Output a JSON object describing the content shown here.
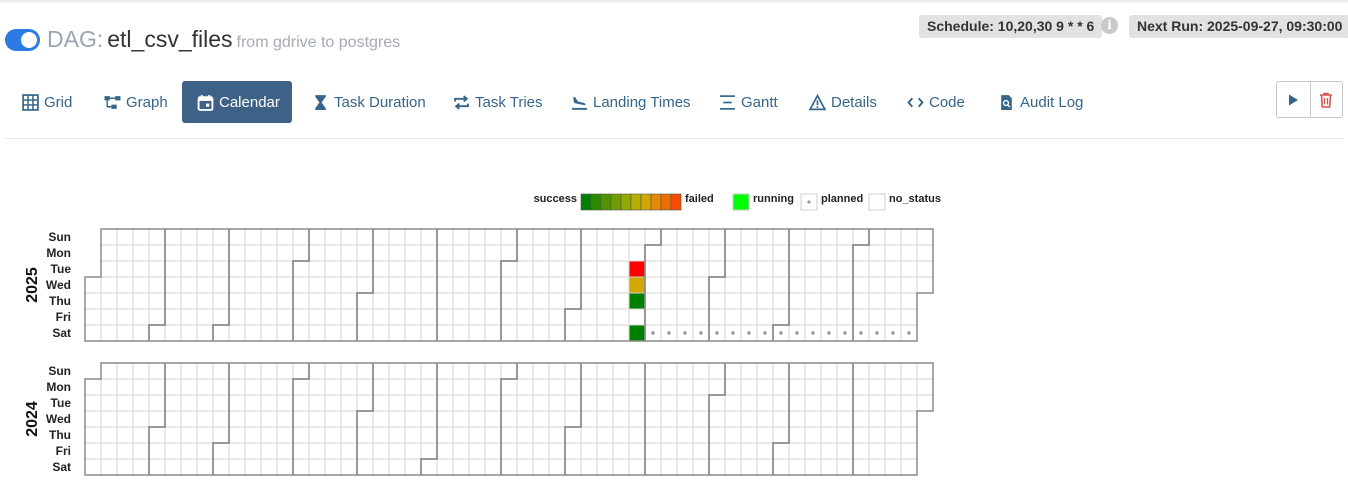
{
  "dag": {
    "toggle_on": true,
    "prefix": "DAG:",
    "name": "etl_csv_files",
    "description": "from gdrive to postgres"
  },
  "schedule_label": "Schedule: 10,20,30 9 * * 6",
  "next_run_label": "Next Run: 2025-09-27, 09:30:00",
  "tabs": [
    {
      "label": "Grid",
      "icon": "grid-icon",
      "active": false
    },
    {
      "label": "Graph",
      "icon": "graph-icon",
      "active": false
    },
    {
      "label": "Calendar",
      "icon": "calendar-icon",
      "active": true
    },
    {
      "label": "Task Duration",
      "icon": "hourglass-icon",
      "active": false
    },
    {
      "label": "Task Tries",
      "icon": "repeat-icon",
      "active": false
    },
    {
      "label": "Landing Times",
      "icon": "plane-landing-icon",
      "active": false
    },
    {
      "label": "Gantt",
      "icon": "gantt-icon",
      "active": false
    },
    {
      "label": "Details",
      "icon": "warning-triangle-icon",
      "active": false
    },
    {
      "label": "Code",
      "icon": "code-icon",
      "active": false
    },
    {
      "label": "Audit Log",
      "icon": "audit-log-icon",
      "active": false
    }
  ],
  "actions": [
    {
      "label": "trigger",
      "icon": "play-icon"
    },
    {
      "label": "delete",
      "icon": "trash-icon",
      "color": "#d9534f"
    }
  ],
  "legend": {
    "success_label": "success",
    "failed_label": "failed",
    "running_label": "running",
    "planned_label": "planned",
    "no_status_label": "no_status",
    "gradient": [
      "#008000",
      "#2c8a00",
      "#4f9400",
      "#709e00",
      "#93a800",
      "#b5b000",
      "#d4a600",
      "#e38a00",
      "#ee6d00",
      "#f74b00"
    ],
    "running_color": "#00ff00"
  },
  "day_labels": [
    "Sun",
    "Mon",
    "Tue",
    "Wed",
    "Thu",
    "Fri",
    "Sat"
  ],
  "years": [
    {
      "year": "2025",
      "runs": [
        {
          "date": "2025-08-26",
          "status": "failed",
          "color": "#ff0000"
        },
        {
          "date": "2025-08-27",
          "status": "partial",
          "color": "#d4a600"
        },
        {
          "date": "2025-08-28",
          "status": "success",
          "color": "#008000"
        },
        {
          "date": "2025-08-30",
          "status": "success",
          "color": "#008000"
        }
      ],
      "planned_from": "2025-09-06"
    },
    {
      "year": "2024",
      "runs": []
    }
  ]
}
